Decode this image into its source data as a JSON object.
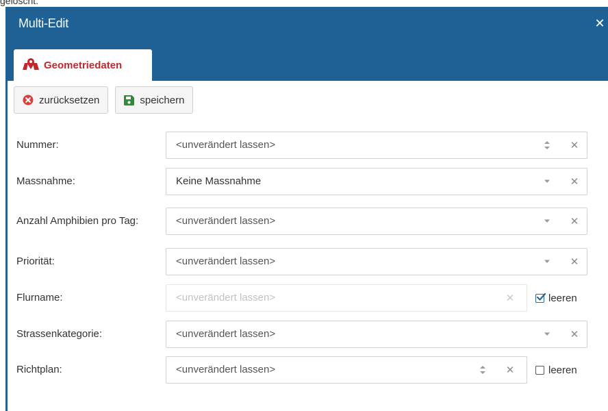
{
  "page_top_text": "gelöscht.",
  "dialog": {
    "title": "Multi-Edit",
    "close_icon": "close-icon",
    "tab": {
      "label": "Geometriedaten",
      "icon": "map-marker-icon",
      "color": "#c1272d"
    },
    "header_color": "#1f6194"
  },
  "toolbar": {
    "reset_label": "zurücksetzen",
    "reset_icon": "times-circle-icon",
    "save_label": "speichern",
    "save_icon": "floppy-disk-icon"
  },
  "fields": [
    {
      "label": "Nummer:",
      "value": "<unverändert lassen>",
      "control": "spinner"
    },
    {
      "label": "Massnahme:",
      "value": "Keine Massnahme",
      "control": "dropdown"
    },
    {
      "label": "Anzahl Amphibien pro Tag:",
      "value": "<unverändert lassen>",
      "control": "dropdown"
    },
    {
      "label": "Priorität:",
      "value": "<unverändert lassen>",
      "control": "dropdown"
    },
    {
      "label": "Flurname:",
      "value": "<unverändert lassen>",
      "control": "text",
      "disabled": true,
      "clear_label": "leeren",
      "clear_checked": true
    },
    {
      "label": "Strassenkategorie:",
      "value": "<unverändert lassen>",
      "control": "dropdown"
    },
    {
      "label": "Richtplan:",
      "value": "<unverändert lassen>",
      "control": "spinner",
      "clear_label": "leeren",
      "clear_checked": false
    }
  ]
}
